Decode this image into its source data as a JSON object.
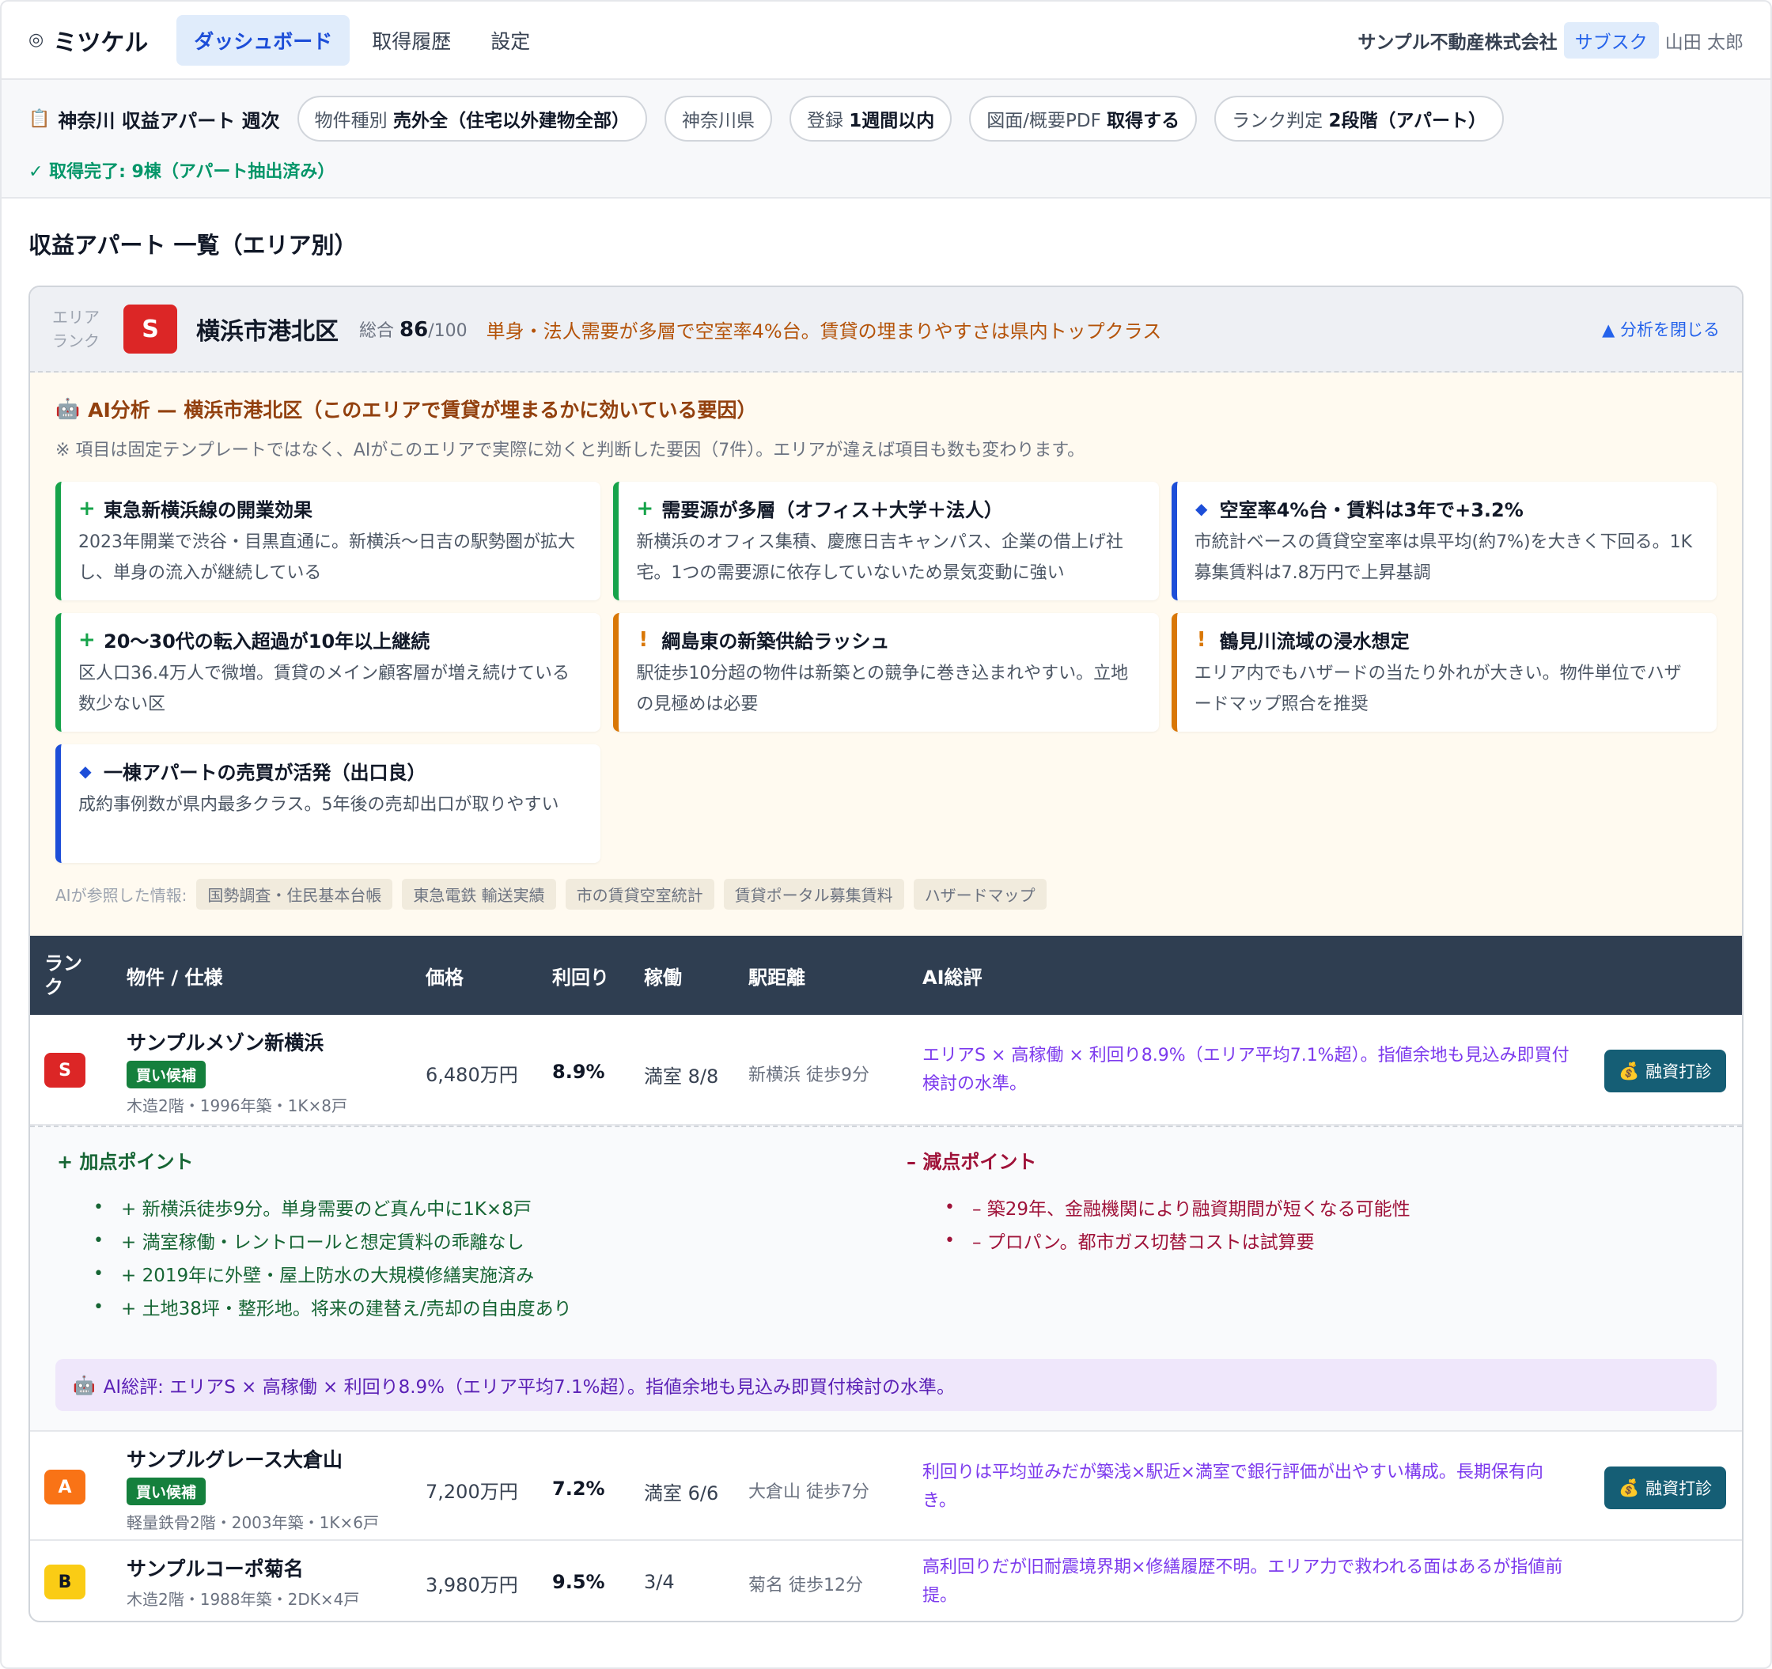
{
  "nav": {
    "logo_mark": "◎",
    "logo": "ミツケル",
    "tabs": [
      "ダッシュボード",
      "取得履歴",
      "設定"
    ],
    "company": "サンプル不動産株式会社",
    "plan": "サブスク",
    "user": "山田 太郎"
  },
  "query": {
    "icon": "clipboard-icon",
    "title": "神奈川 収益アパート 週次",
    "chips": [
      {
        "label": "物件種別",
        "value": "売外全（住宅以外建物全部）"
      },
      {
        "label": "神奈川県",
        "value": ""
      },
      {
        "label": "登録",
        "value": "1週間以内"
      },
      {
        "label": "図面/概要PDF",
        "value": "取得する"
      },
      {
        "label": "ランク判定",
        "value": "2段階（アパート）"
      }
    ],
    "status": "✓ 取得完了: 9棟（アパート抽出済み）"
  },
  "section_title": "収益アパート 一覧（エリア別）",
  "area": {
    "label_line1": "エリア",
    "label_line2": "ランク",
    "rank": "S",
    "name": "横浜市港北区",
    "score_label": "総合",
    "score": "86",
    "score_max": "/100",
    "summary": "単身・法人需要が多層で空室率4%台。賃貸の埋まりやすさは県内トップクラス",
    "close_label": "▲ 分析を閉じる"
  },
  "ai": {
    "robot_icon": "robot-icon",
    "title": "AI分析 — 横浜市港北区（このエリアで賃貸が埋まるかに効いている要因）",
    "note": "※ 項目は固定テンプレートではなく、AIがこのエリアで実際に効くと判断した要因（7件）。エリアが違えば項目も数も変わります。",
    "factors": [
      {
        "type": "plus",
        "symbol": "+",
        "title": "東急新横浜線の開業効果",
        "body": "2023年開業で渋谷・目黒直通に。新横浜〜日吉の駅勢圏が拡大し、単身の流入が継続している"
      },
      {
        "type": "plus",
        "symbol": "+",
        "title": "需要源が多層（オフィス＋大学＋法人）",
        "body": "新横浜のオフィス集積、慶應日吉キャンパス、企業の借上げ社宅。1つの需要源に依存していないため景気変動に強い"
      },
      {
        "type": "info",
        "symbol": "◆",
        "title": "空室率4%台・賃料は3年で+3.2%",
        "body": "市統計ベースの賃貸空室率は県平均(約7%)を大きく下回る。1K募集賃料は7.8万円で上昇基調"
      },
      {
        "type": "plus",
        "symbol": "+",
        "title": "20〜30代の転入超過が10年以上継続",
        "body": "区人口36.4万人で微増。賃貸のメイン顧客層が増え続けている数少ない区"
      },
      {
        "type": "warn",
        "symbol": "!",
        "title": "綱島東の新築供給ラッシュ",
        "body": "駅徒歩10分超の物件は新築との競争に巻き込まれやすい。立地の見極めは必要"
      },
      {
        "type": "warn",
        "symbol": "!",
        "title": "鶴見川流域の浸水想定",
        "body": "エリア内でもハザードの当たり外れが大きい。物件単位でハザードマップ照合を推奨"
      },
      {
        "type": "info",
        "symbol": "◆",
        "title": "一棟アパートの売買が活発（出口良）",
        "body": "成約事例数が県内最多クラス。5年後の売却出口が取りやすい"
      }
    ],
    "refs_label": "AIが参照した情報:",
    "refs": [
      "国勢調査・住民基本台帳",
      "東急電鉄 輸送実績",
      "市の賃貸空室統計",
      "賃貸ポータル募集賃料",
      "ハザードマップ"
    ]
  },
  "table": {
    "headers": {
      "rank": "ランク",
      "property": "物件 / 仕様",
      "price": "価格",
      "yield": "利回り",
      "occupancy": "稼働",
      "station": "駅距離",
      "ai": "AI総評"
    },
    "rows": [
      {
        "rank": "S",
        "name": "サンプルメゾン新横浜",
        "badge": "買い候補",
        "spec": "木造2階・1996年築・1K×8戸",
        "price": "6,480万円",
        "yield": "8.9%",
        "occupancy": "満室 8/8",
        "station": "新横浜 徒歩9分",
        "ai": "エリアS × 高稼働 × 利回り8.9%（エリア平均7.1%超）。指値余地も見込み即買付検討の水準。",
        "loan_icon": "money-bag-icon",
        "loan": "融資打診"
      },
      {
        "rank": "A",
        "name": "サンプルグレース大倉山",
        "badge": "買い候補",
        "spec": "軽量鉄骨2階・2003年築・1K×6戸",
        "price": "7,200万円",
        "yield": "7.2%",
        "occupancy": "満室 6/6",
        "station": "大倉山 徒歩7分",
        "ai": "利回りは平均並みだが築浅×駅近×満室で銀行評価が出やすい構成。長期保有向き。",
        "loan_icon": "money-bag-icon",
        "loan": "融資打診"
      },
      {
        "rank": "B",
        "name": "サンプルコーポ菊名",
        "badge": "",
        "spec": "木造2階・1988年築・2DK×4戸",
        "price": "3,980万円",
        "yield": "9.5%",
        "occupancy": "3/4",
        "station": "菊名 徒歩12分",
        "ai": "高利回りだが旧耐震境界期×修繕履歴不明。エリア力で救われる面はあるが指値前提。"
      }
    ]
  },
  "detail": {
    "plus_title": "+ 加点ポイント",
    "plus": [
      "+ 新横浜徒歩9分。単身需要のど真ん中に1K×8戸",
      "+ 満室稼働・レントロールと想定賃料の乖離なし",
      "+ 2019年に外壁・屋上防水の大規模修繕実施済み",
      "+ 土地38坪・整形地。将来の建替え/売却の自由度あり"
    ],
    "minus_title": "– 減点ポイント",
    "minus": [
      "– 築29年、金融機関により融資期間が短くなる可能性",
      "– プロパン。都市ガス切替コストは試算要"
    ],
    "ai_icon": "robot-icon",
    "ai_summary": "AI総評: エリアS × 高稼働 × 利回り8.9%（エリア平均7.1%超）。指値余地も見込み即買付検討の水準。"
  }
}
